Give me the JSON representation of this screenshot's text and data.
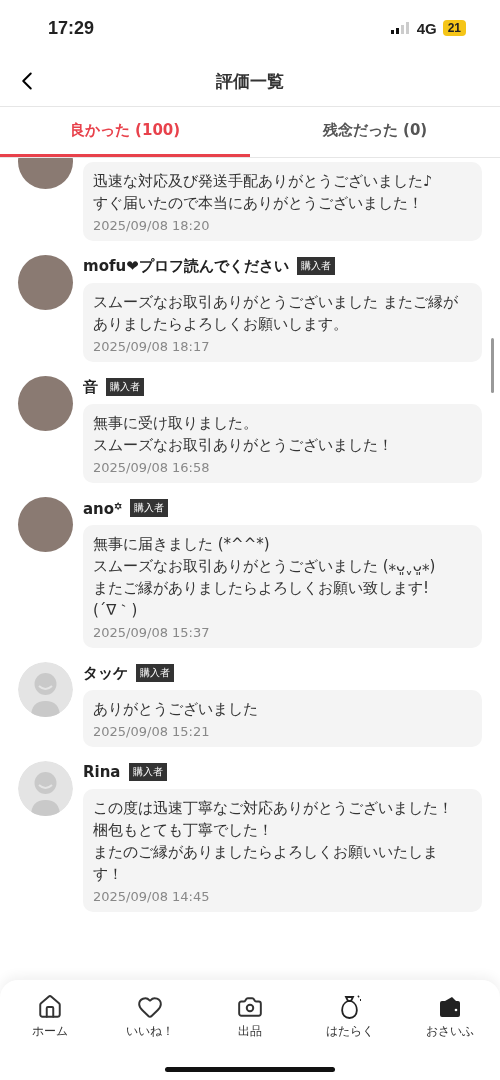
{
  "status_bar": {
    "time": "17:29",
    "network": "4G",
    "battery": "21"
  },
  "header": {
    "title": "評価一覧"
  },
  "tabs": [
    {
      "label": "良かった (100)",
      "selected": true
    },
    {
      "label": "残念だった (0)",
      "selected": false
    }
  ],
  "reviews": [
    {
      "kind": "photo",
      "lines": [
        "迅速な対応及び発送手配ありがとうございました♪",
        "すぐ届いたので本当にありがとうございました！"
      ],
      "date": "2025/09/08 18:20"
    },
    {
      "kind": "photo",
      "name": "mofu❤プロフ読んでください",
      "badge": "購入者",
      "lines": [
        "スムーズなお取引ありがとうございました またご縁がありましたらよろしくお願いします。"
      ],
      "date": "2025/09/08 18:17"
    },
    {
      "kind": "photo",
      "name": "音",
      "badge": "購入者",
      "lines": [
        "無事に受け取りました。",
        "スムーズなお取引ありがとうございました！"
      ],
      "date": "2025/09/08 16:58"
    },
    {
      "kind": "photo",
      "name": "ano꙳",
      "badge": "購入者",
      "lines": [
        "無事に届きました (*^^*)",
        "スムーズなお取引ありがとうございました (⁎ᴗ͈ˬᴗ͈⁎)",
        "またご縁がありましたらよろしくお願い致します!",
        "(´∇｀)"
      ],
      "date": "2025/09/08 15:37"
    },
    {
      "kind": "default",
      "name": "タッケ",
      "badge": "購入者",
      "lines": [
        "ありがとうございました"
      ],
      "date": "2025/09/08 15:21"
    },
    {
      "kind": "default",
      "name": "Rina",
      "badge": "購入者",
      "lines": [
        "この度は迅速丁寧なご対応ありがとうございました！梱包もとても丁寧でした！",
        "またのご縁がありましたらよろしくお願いいたします！"
      ],
      "date": "2025/09/08 14:45"
    }
  ],
  "bottom_nav": [
    {
      "label": "ホーム",
      "kind": "home"
    },
    {
      "label": "いいね！",
      "kind": "heart"
    },
    {
      "label": "出品",
      "kind": "camera"
    },
    {
      "label": "はたらく",
      "kind": "bag"
    },
    {
      "label": "おさいふ",
      "kind": "wallet"
    }
  ]
}
